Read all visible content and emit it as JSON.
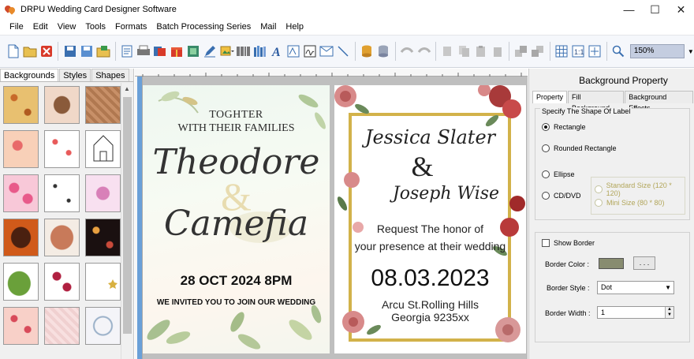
{
  "window": {
    "title": "DRPU Wedding Card Designer Software",
    "minimize": "—",
    "maximize": "☐",
    "close": "✕"
  },
  "menu": [
    "File",
    "Edit",
    "View",
    "Tools",
    "Formats",
    "Batch Processing Series",
    "Mail",
    "Help"
  ],
  "toolbar": {
    "zoom_value": "150%"
  },
  "left_panel": {
    "tabs": [
      "Backgrounds",
      "Styles",
      "Shapes"
    ]
  },
  "card1": {
    "line1": "TOGHTER",
    "line2": "WITH THEIR FAMILIES",
    "name1": "Theodore",
    "amp": "&",
    "name2": "Camefia",
    "date": "28 OCT 2024 8PM",
    "invite": "WE INVITED YOU TO JOIN OUR WEDDING"
  },
  "card2": {
    "name1": "Jessica Slater",
    "amp": "&",
    "name2": "Joseph Wise",
    "request1": "Request The honor of",
    "request2": "your presence at their wedding",
    "date": "08.03.2023",
    "address1": "Arcu St.Rolling  Hills",
    "address2": "Georgia  9235xx"
  },
  "right_panel": {
    "title": "Background Property",
    "tabs": [
      "Property",
      "Fill Background",
      "Background Effects"
    ],
    "shape_group_label": "Specify The Shape Of Label",
    "shape_rectangle": "Rectangle",
    "shape_rounded": "Rounded Rectangle",
    "shape_ellipse": "Ellipse",
    "shape_cd": "CD/DVD",
    "cd_standard": "Standard Size (120 * 120)",
    "cd_mini": "Mini Size (80 * 80)",
    "show_border": "Show Border",
    "border_color_label": "Border Color :",
    "border_color_button": ". . .",
    "border_style_label": "Border Style :",
    "border_style_value": "Dot",
    "border_width_label": "Border Width :",
    "border_width_value": "1",
    "border_color_hex": "#888c70"
  }
}
